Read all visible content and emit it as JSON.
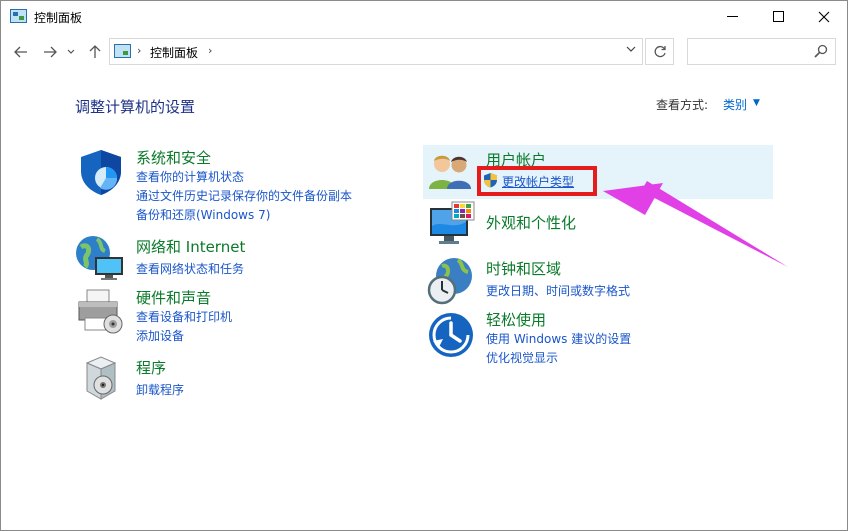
{
  "window": {
    "title": "控制面板",
    "controls": {
      "minimize": "─",
      "maximize": "□",
      "close": "✕"
    }
  },
  "nav": {
    "back": "←",
    "forward": "→",
    "recent": "⌄",
    "up": "↑",
    "breadcrumb_sep": "›",
    "address": "控制面板",
    "address_dropdown": "⌄",
    "refresh": "↻",
    "search_placeholder": ""
  },
  "main": {
    "heading": "调整计算机的设置",
    "view_by_label": "查看方式:",
    "view_by_value": "类别",
    "view_by_caret": "▼",
    "left_categories": [
      {
        "title": "系统和安全",
        "links": [
          "查看你的计算机状态",
          "通过文件历史记录保存你的文件备份副本",
          "备份和还原(Windows 7)"
        ]
      },
      {
        "title": "网络和 Internet",
        "links": [
          "查看网络状态和任务"
        ]
      },
      {
        "title": "硬件和声音",
        "links": [
          "查看设备和打印机",
          "添加设备"
        ]
      },
      {
        "title": "程序",
        "links": [
          "卸载程序"
        ]
      }
    ],
    "right_categories": [
      {
        "title": "用户帐户",
        "links": [
          "更改帐户类型"
        ]
      },
      {
        "title": "外观和个性化",
        "links": []
      },
      {
        "title": "时钟和区域",
        "links": [
          "更改日期、时间或数字格式"
        ]
      },
      {
        "title": "轻松使用",
        "links": [
          "使用 Windows 建议的设置",
          "优化视觉显示"
        ]
      }
    ]
  },
  "colors": {
    "category_title": "#0a7a2a",
    "link": "#1a56c9",
    "heading": "#1e3287",
    "highlight": "#e5f3fb",
    "annotation_box": "#e51c1c",
    "annotation_arrow": "#e040e6"
  }
}
